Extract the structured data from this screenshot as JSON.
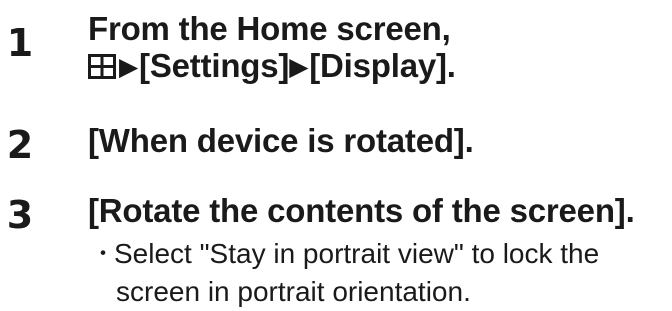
{
  "steps": [
    {
      "number": "1",
      "line1": "From the Home screen,",
      "icon": "apps-grid-icon",
      "arrow": "▶",
      "item1": "[Settings]",
      "item2": "[Display]."
    },
    {
      "number": "2",
      "text": "[When device is rotated]."
    },
    {
      "number": "3",
      "text": "[Rotate the contents of the screen].",
      "note": {
        "bullet": "・",
        "line1": "Select \"Stay in portrait view\" to lock the",
        "line2": "screen in portrait orientation."
      }
    }
  ]
}
